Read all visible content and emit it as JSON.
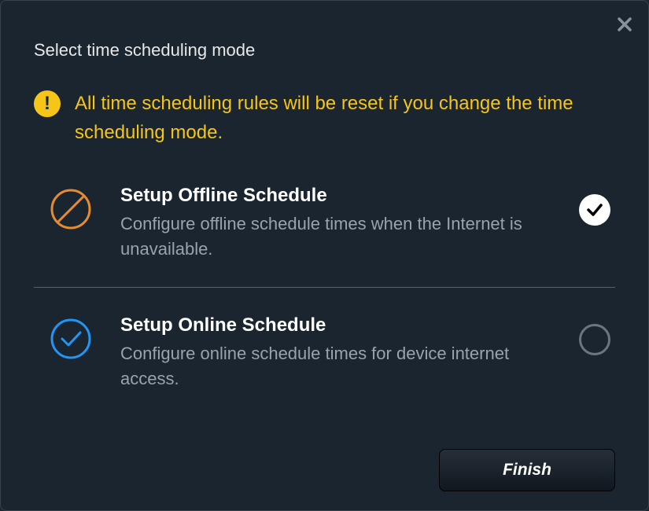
{
  "dialog": {
    "title": "Select time scheduling mode",
    "warning": "All time scheduling rules will be reset if you change the time scheduling mode.",
    "options": [
      {
        "title": "Setup Offline Schedule",
        "desc": "Configure offline schedule times when the Internet is unavailable.",
        "selected": true
      },
      {
        "title": "Setup Online Schedule",
        "desc": "Configure online schedule times for device internet access.",
        "selected": false
      }
    ],
    "buttons": {
      "finish": "Finish"
    }
  },
  "colors": {
    "accent_yellow": "#f5c518",
    "accent_orange": "#e88b2e",
    "accent_blue": "#2196f3"
  }
}
